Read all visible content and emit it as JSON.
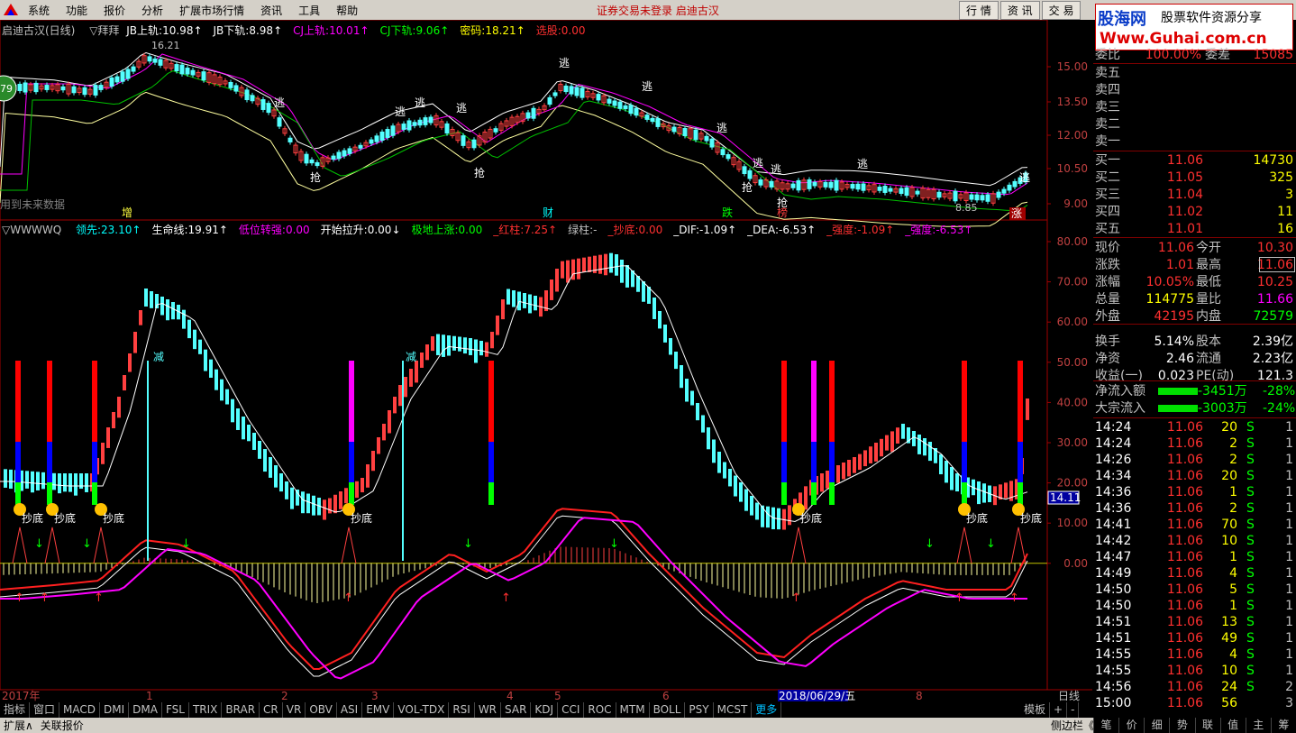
{
  "menu": {
    "items": [
      "系统",
      "功能",
      "报价",
      "分析",
      "扩展市场行情",
      "资讯",
      "工具",
      "帮助"
    ],
    "notice": "证券交易未登录 启迪古汉",
    "right_buttons": [
      "行 情",
      "资 讯",
      "交 易"
    ]
  },
  "watermark": {
    "line1": "股海网",
    "line2": "股票软件资源分享",
    "line3": "Www.Guhai.com.cn"
  },
  "main_legend": {
    "title": "启迪古汉(日线)",
    "indicator_name": "▽拜拜",
    "items": [
      {
        "label": "JB上轨:",
        "value": "10.98",
        "arrow": "↑",
        "color": "#ffffff"
      },
      {
        "label": "JB下轨:",
        "value": "8.98",
        "arrow": "↑",
        "color": "#ffffff"
      },
      {
        "label": "CJ上轨:",
        "value": "10.01",
        "arrow": "↑",
        "color": "#ff00ff"
      },
      {
        "label": "CJ下轨:",
        "value": "9.06",
        "arrow": "↑",
        "color": "#00ff00"
      },
      {
        "label": "密码:",
        "value": "18.21",
        "arrow": "↑",
        "color": "#ffff00"
      },
      {
        "label": "选股:",
        "value": "0.00",
        "arrow": "",
        "color": "#ff3030"
      }
    ],
    "high_label": "16.21",
    "low_label": "8.85",
    "future_note": "用到未来数据",
    "badge": "79"
  },
  "main_y_axis": [
    "15.00",
    "13.50",
    "12.00",
    "10.50",
    "9.00"
  ],
  "sub_legend": {
    "name": "▽WWWWQ",
    "items": [
      {
        "label": "领先:",
        "value": "23.10",
        "arrow": "↑",
        "color": "#00ffff"
      },
      {
        "label": "生命线:",
        "value": "19.91",
        "arrow": "↑",
        "color": "#ffffff"
      },
      {
        "label": "低位转强:",
        "value": "0.00",
        "arrow": "",
        "color": "#ff00ff"
      },
      {
        "label": "开始拉升:",
        "value": "0.00",
        "arrow": "↓",
        "color": "#ffffff"
      },
      {
        "label": "极地上涨:",
        "value": "0.00",
        "arrow": "",
        "color": "#00ff00"
      },
      {
        "label": "_红柱:",
        "value": "7.25",
        "arrow": "↑",
        "color": "#ff3030"
      },
      {
        "label": "绿柱:",
        "value": "-",
        "arrow": "",
        "color": "#c0c0c0"
      },
      {
        "label": "_抄底:",
        "value": "0.00",
        "arrow": "",
        "color": "#ff3030"
      },
      {
        "label": "_DIF:",
        "value": "-1.09",
        "arrow": "↑",
        "color": "#ffffff"
      },
      {
        "label": "_DEA:",
        "value": "-6.53",
        "arrow": "↑",
        "color": "#ffffff"
      },
      {
        "label": "_强度:",
        "value": "-1.09",
        "arrow": "↑",
        "color": "#ff3030"
      },
      {
        "label": "_强度:",
        "value": "-6.53",
        "arrow": "↑",
        "color": "#ff00ff"
      }
    ]
  },
  "sub_y_axis": [
    "80.00",
    "70.00",
    "60.00",
    "50.00",
    "40.00",
    "30.00",
    "20.00",
    "10.00",
    "0.00"
  ],
  "cursor_value": "14.11",
  "signals": {
    "escape": "逃",
    "grab": "抢",
    "bottom": "抄底",
    "rise": "涨",
    "fall": "跌",
    "increase": "增",
    "reduce": "减",
    "report": "财",
    "hold": "榜"
  },
  "x_axis": {
    "labels": [
      "2017年",
      "1",
      "2",
      "3",
      "4",
      "5",
      "6",
      "2018/06/29/五",
      "8"
    ],
    "period": "日线"
  },
  "bottom_tabs": [
    "指标",
    "窗口",
    "MACD",
    "DMI",
    "DMA",
    "FSL",
    "TRIX",
    "BRAR",
    "CR",
    "VR",
    "OBV",
    "ASI",
    "EMV",
    "VOL-TDX",
    "RSI",
    "WR",
    "SAR",
    "KDJ",
    "CCI",
    "ROC",
    "MTM",
    "BOLL",
    "PSY",
    "MCST",
    "更多"
  ],
  "bottom_right": [
    "模板",
    "+",
    "-"
  ],
  "status": {
    "left": "扩展∧",
    "link": "关联报价",
    "side": "侧边栏《"
  },
  "right_tabs": [
    "笔",
    "价",
    "细",
    "势",
    "联",
    "值",
    "主",
    "筹"
  ],
  "orderbook": {
    "weibi_label": "委比",
    "weibi": "100.00%",
    "weicha_label": "委差",
    "weicha": "15085",
    "sells": [
      {
        "label": "卖五"
      },
      {
        "label": "卖四"
      },
      {
        "label": "卖三"
      },
      {
        "label": "卖二"
      },
      {
        "label": "卖一"
      }
    ],
    "buys": [
      {
        "label": "买一",
        "price": "11.06",
        "vol": "14730"
      },
      {
        "label": "买二",
        "price": "11.05",
        "vol": "325"
      },
      {
        "label": "买三",
        "price": "11.04",
        "vol": "3"
      },
      {
        "label": "买四",
        "price": "11.02",
        "vol": "11"
      },
      {
        "label": "买五",
        "price": "11.01",
        "vol": "16"
      }
    ]
  },
  "quote": [
    {
      "l1": "现价",
      "v1": "11.06",
      "c1": "#ff3030",
      "l2": "今开",
      "v2": "10.30",
      "c2": "#ff3030"
    },
    {
      "l1": "涨跌",
      "v1": "1.01",
      "c1": "#ff3030",
      "l2": "最高",
      "v2": "11.06",
      "c2": "#ff3030"
    },
    {
      "l1": "涨幅",
      "v1": "10.05%",
      "c1": "#ff3030",
      "l2": "最低",
      "v2": "10.25",
      "c2": "#ff3030"
    },
    {
      "l1": "总量",
      "v1": "114775",
      "c1": "#ffff00",
      "l2": "量比",
      "v2": "11.66",
      "c2": "#ff00ff"
    },
    {
      "l1": "外盘",
      "v1": "42195",
      "c1": "#ff3030",
      "l2": "内盘",
      "v2": "72579",
      "c2": "#00ff00"
    },
    {
      "l1": "换手",
      "v1": "5.14%",
      "c1": "#ffffff",
      "l2": "股本",
      "v2": "2.39亿",
      "c2": "#ffffff"
    },
    {
      "l1": "净资",
      "v1": "2.46",
      "c1": "#ffffff",
      "l2": "流通",
      "v2": "2.23亿",
      "c2": "#ffffff"
    },
    {
      "l1": "收益(一)",
      "v1": "0.023",
      "c1": "#ffffff",
      "l2": "PE(动)",
      "v2": "121.3",
      "c2": "#ffffff"
    }
  ],
  "flows": [
    {
      "label": "净流入额",
      "value": "-3451万",
      "pct": "-28%"
    },
    {
      "label": "大宗流入",
      "value": "-3003万",
      "pct": "-24%"
    }
  ],
  "ticks": [
    {
      "t": "14:24",
      "p": "11.06",
      "v": "20",
      "s": "S",
      "n": "1"
    },
    {
      "t": "14:24",
      "p": "11.06",
      "v": "2",
      "s": "S",
      "n": "1"
    },
    {
      "t": "14:26",
      "p": "11.06",
      "v": "2",
      "s": "S",
      "n": "1"
    },
    {
      "t": "14:34",
      "p": "11.06",
      "v": "20",
      "s": "S",
      "n": "1"
    },
    {
      "t": "14:36",
      "p": "11.06",
      "v": "1",
      "s": "S",
      "n": "1"
    },
    {
      "t": "14:36",
      "p": "11.06",
      "v": "2",
      "s": "S",
      "n": "1"
    },
    {
      "t": "14:41",
      "p": "11.06",
      "v": "70",
      "s": "S",
      "n": "1"
    },
    {
      "t": "14:42",
      "p": "11.06",
      "v": "10",
      "s": "S",
      "n": "1"
    },
    {
      "t": "14:47",
      "p": "11.06",
      "v": "1",
      "s": "S",
      "n": "1"
    },
    {
      "t": "14:49",
      "p": "11.06",
      "v": "4",
      "s": "S",
      "n": "1"
    },
    {
      "t": "14:50",
      "p": "11.06",
      "v": "5",
      "s": "S",
      "n": "1"
    },
    {
      "t": "14:50",
      "p": "11.06",
      "v": "1",
      "s": "S",
      "n": "1"
    },
    {
      "t": "14:51",
      "p": "11.06",
      "v": "13",
      "s": "S",
      "n": "1"
    },
    {
      "t": "14:51",
      "p": "11.06",
      "v": "49",
      "s": "S",
      "n": "1"
    },
    {
      "t": "14:55",
      "p": "11.06",
      "v": "4",
      "s": "S",
      "n": "1"
    },
    {
      "t": "14:55",
      "p": "11.06",
      "v": "10",
      "s": "S",
      "n": "1"
    },
    {
      "t": "14:56",
      "p": "11.06",
      "v": "24",
      "s": "S",
      "n": "2"
    },
    {
      "t": "15:00",
      "p": "11.06",
      "v": "56",
      "s": "",
      "n": "3"
    }
  ]
}
